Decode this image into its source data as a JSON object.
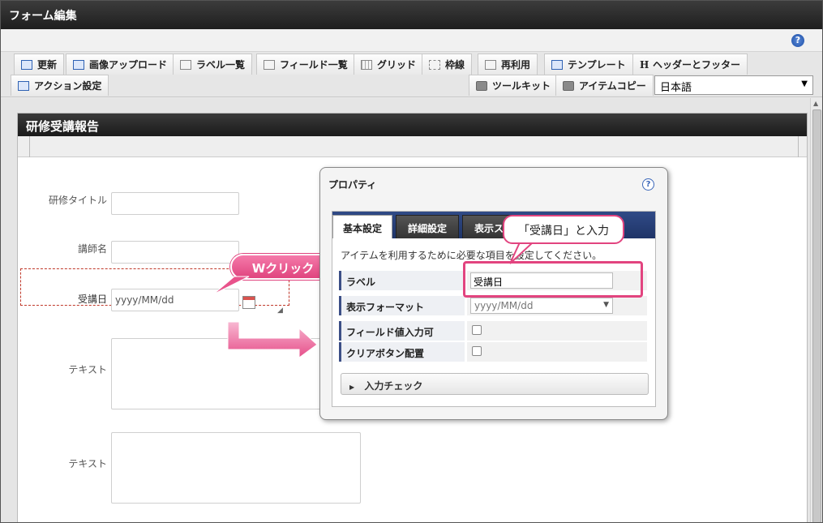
{
  "window": {
    "title": "フォーム編集"
  },
  "toolbar": {
    "row1": [
      {
        "label": "更新",
        "icon": "update-icon"
      },
      {
        "label": "画像アップロード",
        "icon": "image-upload-icon"
      },
      {
        "label": "ラベル一覧",
        "icon": "label-list-icon"
      },
      {
        "label": "フィールド一覧",
        "icon": "field-list-icon"
      },
      {
        "label": "グリッド",
        "icon": "grid-icon"
      },
      {
        "label": "枠線",
        "icon": "border-icon"
      },
      {
        "label": "再利用",
        "icon": "reuse-icon"
      },
      {
        "label": "テンプレート",
        "icon": "template-icon"
      },
      {
        "label": "ヘッダーとフッター",
        "icon": "header-footer-icon"
      }
    ],
    "action_setting": "アクション設定",
    "toolkit": "ツールキット",
    "item_copy": "アイテムコピー",
    "language": "日本語"
  },
  "form": {
    "title": "研修受講報告",
    "fields": {
      "training_title": "研修タイトル",
      "instructor": "講師名",
      "attend_date": "受講日",
      "attend_date_placeholder": "yyyy/MM/dd",
      "text1": "テキスト",
      "text2": "テキスト"
    }
  },
  "annotations": {
    "double_click": "Wクリック",
    "enter_hint": "「受講日」と入力"
  },
  "properties": {
    "title": "プロパティ",
    "tabs": [
      "基本設定",
      "詳細設定",
      "表示ス"
    ],
    "description": "アイテムを利用するために必要な項目を設定してください。",
    "rows": {
      "label": "ラベル",
      "label_value": "受講日",
      "format": "表示フォーマット",
      "format_value": "yyyy/MM/dd",
      "field_input": "フィールド値入力可",
      "clear_button": "クリアボタン配置"
    },
    "input_check": "入力チェック"
  }
}
